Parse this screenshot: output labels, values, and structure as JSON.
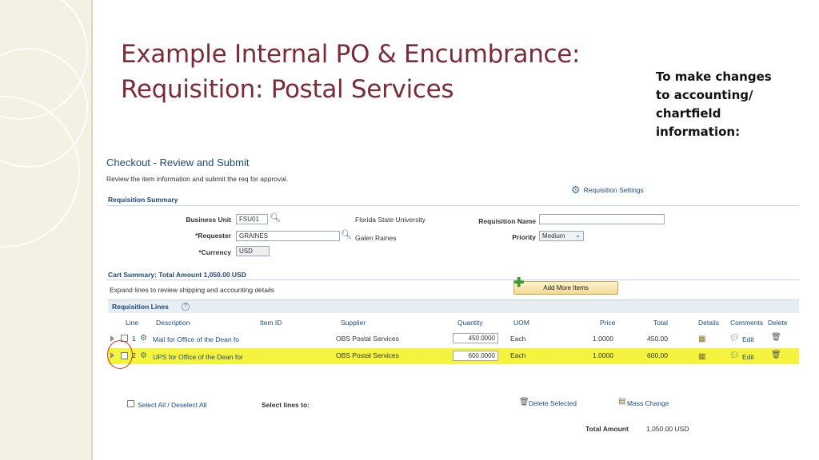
{
  "slide": {
    "title_line1": "Example Internal PO & Encumbrance:",
    "title_line2": "Requisition: Postal Services",
    "note_lines": [
      "To make changes",
      "to accounting/",
      "chartfield",
      "information:"
    ]
  },
  "page": {
    "title": "Checkout - Review and Submit",
    "subtitle": "Review the item information and submit the req for approval.",
    "settings_link": "Requisition Settings"
  },
  "summary": {
    "section_title": "Requisition Summary",
    "business_unit_label": "Business Unit",
    "business_unit_value": "FSU01",
    "business_unit_desc": "Florida State University",
    "requester_label": "*Requester",
    "requester_value": "GRAINES",
    "requester_desc": "Galen Raines",
    "currency_label": "*Currency",
    "currency_value": "USD",
    "req_name_label": "Requisition Name",
    "req_name_value": "",
    "priority_label": "Priority",
    "priority_value": "Medium"
  },
  "cart": {
    "summary_title": "Cart Summary: Total Amount 1,050.00 USD",
    "expand_text": "Expand lines to review shipping and accounting details",
    "add_more_label": "Add More Items"
  },
  "lines": {
    "section_title": "Requisition Lines",
    "columns": {
      "line": "Line",
      "description": "Description",
      "item_id": "Item ID",
      "supplier": "Supplier",
      "quantity": "Quantity",
      "uom": "UOM",
      "price": "Price",
      "total": "Total",
      "details": "Details",
      "comments": "Comments",
      "delete": "Delete"
    },
    "rows": [
      {
        "line": "1",
        "description": "Mail for Office of the Dean fo",
        "supplier": "OBS Postal Services",
        "quantity": "450.0000",
        "uom": "Each",
        "price": "1.0000",
        "total": "450.00",
        "comment": "Edit"
      },
      {
        "line": "2",
        "description": "UPS for Office of the Dean for",
        "supplier": "OBS Postal Services",
        "quantity": "600.0000",
        "uom": "Each",
        "price": "1.0000",
        "total": "600.00",
        "comment": "Edit"
      }
    ]
  },
  "footer": {
    "select_all": "Select All / Deselect All",
    "select_lines": "Select lines to:",
    "delete_selected": "Delete Selected",
    "mass_change": "Mass Change",
    "total_label": "Total Amount",
    "total_value": "1,050.00 USD"
  },
  "colors": {
    "title": "#7a2c3a",
    "link": "#1d4a7c",
    "highlight": "#f4f43e",
    "circle": "#c0392b"
  }
}
